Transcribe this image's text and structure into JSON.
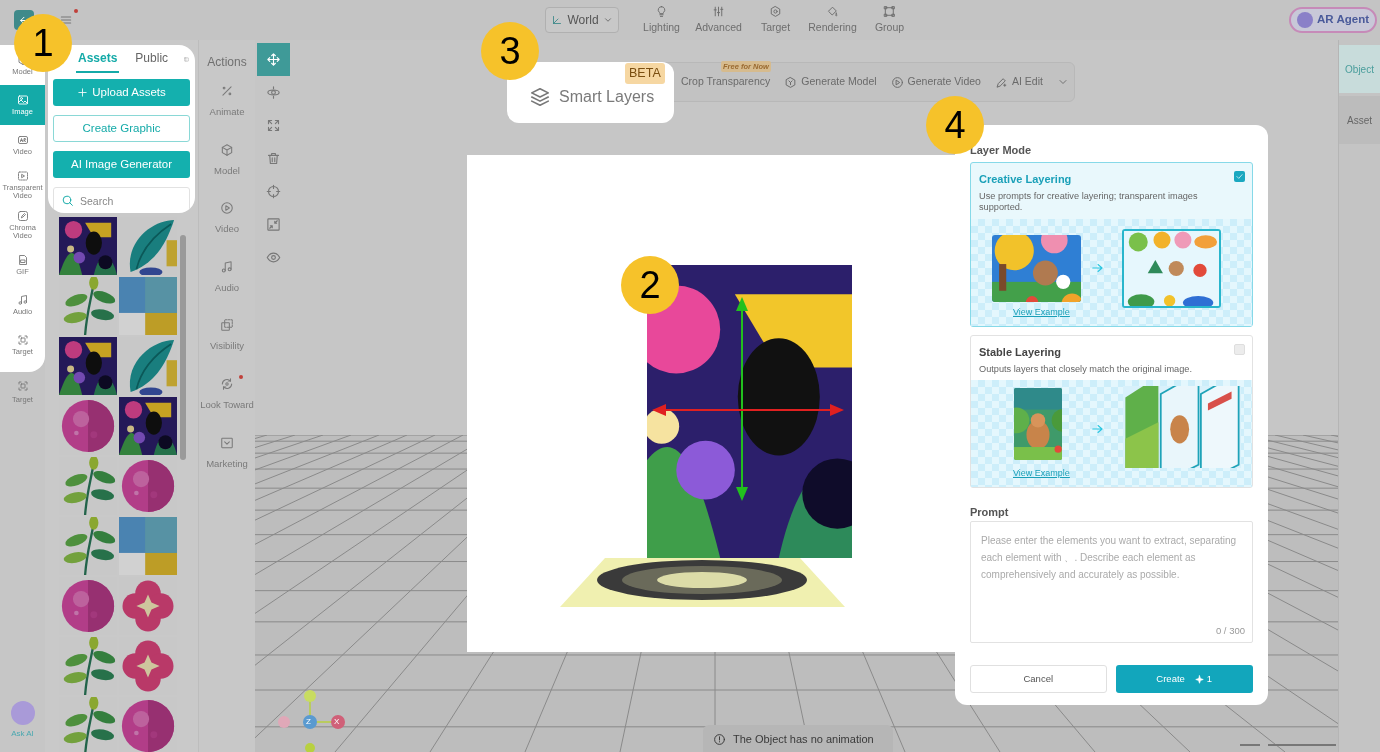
{
  "top_bar": {
    "menu_alert": true,
    "view_mode": "World",
    "tools": [
      "Lighting",
      "Advanced",
      "Target",
      "Rendering",
      "Group"
    ],
    "agent_button": "AR Agent"
  },
  "left_rail": {
    "items": [
      {
        "label": "Model",
        "selected": false
      },
      {
        "label": "Image",
        "selected": true
      },
      {
        "label": "Video",
        "selected": false
      },
      {
        "label": "Transparent Video",
        "selected": false
      },
      {
        "label": "Chroma Video",
        "selected": false
      },
      {
        "label": "GIF",
        "selected": false
      },
      {
        "label": "Audio",
        "selected": false
      },
      {
        "label": "Target",
        "selected": false
      }
    ],
    "extra_item": "Target",
    "assistant": "Ask AI"
  },
  "assets_panel": {
    "tabs": [
      {
        "label": "Assets",
        "selected": true
      },
      {
        "label": "Public",
        "selected": false
      }
    ],
    "buttons": [
      {
        "label": "Upload Assets",
        "kind": "primary"
      },
      {
        "label": "Create Graphic",
        "kind": "outline"
      },
      {
        "label": "AI Image Generator",
        "kind": "primary"
      }
    ],
    "search": {
      "placeholder": "Search"
    }
  },
  "actions_panel": {
    "title": "Actions",
    "items": [
      {
        "label": "Animate",
        "alert": false
      },
      {
        "label": "Model",
        "alert": false
      },
      {
        "label": "Video",
        "alert": false
      },
      {
        "label": "Audio",
        "alert": false
      },
      {
        "label": "Visibility",
        "alert": false
      },
      {
        "label": "Look Toward",
        "alert": true
      },
      {
        "label": "Marketing",
        "alert": false
      }
    ]
  },
  "transform_tools": [
    {
      "selected": true
    },
    {
      "selected": false
    },
    {
      "selected": false
    },
    {
      "selected": false
    },
    {
      "selected": false
    },
    {
      "selected": false
    },
    {
      "selected": false
    }
  ],
  "image_toolbar": {
    "smart_layers": {
      "label": "Smart Layers",
      "badge": "BETA"
    },
    "items": [
      {
        "label": "Crop Transparency",
        "badge": "Free for Now"
      },
      {
        "label": "Generate Model"
      },
      {
        "label": "Generate Video"
      },
      {
        "label": "AI Edit"
      }
    ]
  },
  "layer_dialog": {
    "section_label": "Layer Mode",
    "modes": [
      {
        "title": "Creative Layering",
        "description": "Use prompts for creative layering; transparent images supported.",
        "link": "View Example",
        "checked": true
      },
      {
        "title": "Stable Layering",
        "description": "Outputs layers that closely match the original image.",
        "link": "View Example",
        "checked": false
      }
    ],
    "prompt_label": "Prompt",
    "prompt": {
      "placeholder": "Please enter the elements you want to extract, separating each element with 、. Describe each element as comprehensively and accurately as possible."
    },
    "counter": "0 / 300",
    "cancel_button": "Cancel",
    "create_button": {
      "label": "Create",
      "cost": "1"
    }
  },
  "right_tabs": [
    {
      "label": "Object",
      "selected": true
    },
    {
      "label": "Asset",
      "selected": false
    }
  ],
  "axis_gizmo": [
    "Z",
    "X"
  ],
  "status_toast": "The Object has no animation",
  "callouts": [
    "1",
    "2",
    "3",
    "4"
  ]
}
